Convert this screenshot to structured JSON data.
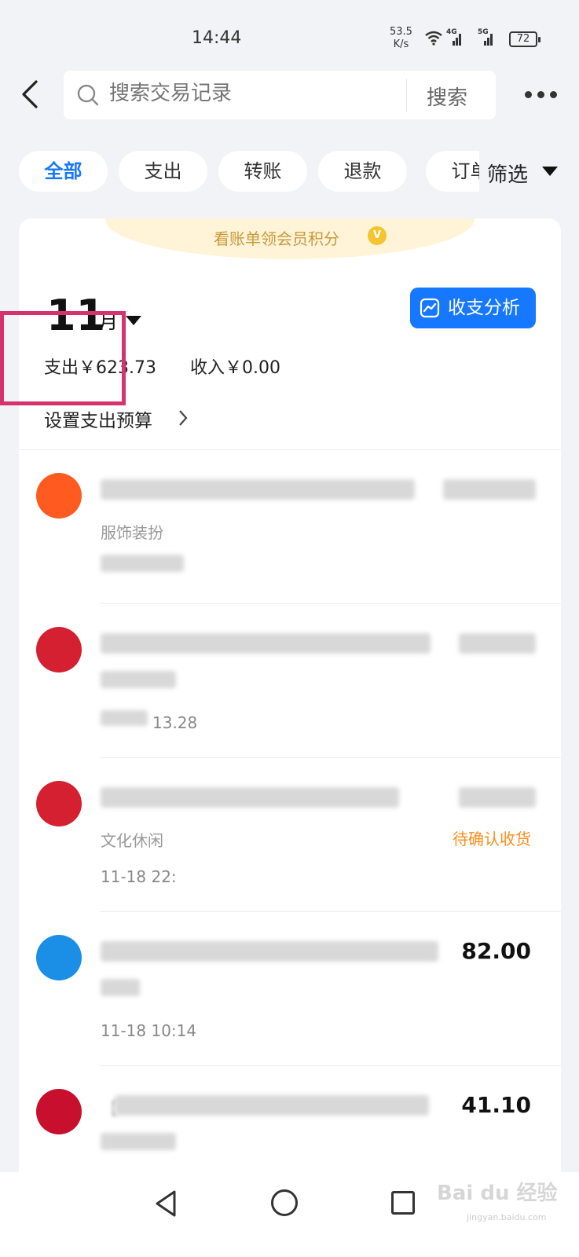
{
  "status_bar": {
    "time": "14:44",
    "net_speed_value": "53.5",
    "net_speed_unit": "K/s",
    "network_1": "4G",
    "network_2": "5G",
    "battery": "72"
  },
  "header": {
    "search_placeholder": "搜索交易记录",
    "search_button": "搜索"
  },
  "filters": {
    "chips": [
      "全部",
      "支出",
      "转账",
      "退款",
      "订单"
    ],
    "active_index": 0,
    "filter_label": "筛选"
  },
  "summary": {
    "promo_text": "看账单领会员积分",
    "promo_badge": "V",
    "month_number": "11",
    "month_unit": "月",
    "analysis_button": "收支分析",
    "expense": "支出￥623.73",
    "income": "收入￥0.00",
    "budget_link": "设置支出预算"
  },
  "transactions": [
    {
      "title": "",
      "category": "服饰装扮",
      "date": "",
      "amount": "",
      "status": ""
    },
    {
      "title": "",
      "category": "",
      "date": "13.28",
      "amount": "",
      "status": ""
    },
    {
      "title": "",
      "category": "文化休闲",
      "date": "11-18 22:",
      "amount": "",
      "status": "待确认收货"
    },
    {
      "title": "",
      "category": "",
      "date": "11-18 10:14",
      "amount": "82.00",
      "status": ""
    },
    {
      "title": "【",
      "category": "",
      "date": "",
      "amount": "41.10",
      "status": ""
    }
  ],
  "colors": {
    "accent": "#1677ff",
    "highlight_box": "#d6326e",
    "pending_status": "#ff8d1a",
    "promo_bg": "#fff4d8"
  },
  "watermark": {
    "brand": "Bai du 经验",
    "url": "jingyan.baidu.com"
  }
}
